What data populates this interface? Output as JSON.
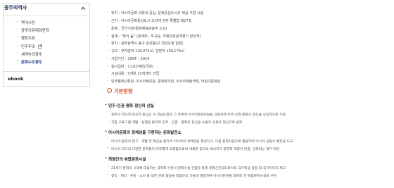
{
  "sidebar": {
    "header": "광주의역사",
    "items": [
      {
        "label": "역대시장",
        "active": false
      },
      {
        "label": "광주의유래와연혁",
        "active": false
      },
      {
        "label": "행정지표",
        "active": false
      },
      {
        "label": "민주주의",
        "active": false,
        "external": true
      },
      {
        "label": "세계속의광주",
        "active": false
      },
      {
        "label": "문화수도광주",
        "active": true
      }
    ],
    "ebook": "ebook"
  },
  "main": {
    "overview": [
      "위치 : 아시아문화 교류의 중심, 문화중심도시의 핵심 거점 시설",
      "근거 : 아시아문화중심도시 조성에 관한 특별법 제27조",
      "운영 : 국가기관(문화체육관광부 소속)",
      "설계 : \"빛의 숲\" (설계자 : 우규승, 국제건축설계경기 당선작)",
      "위치 : 광주광역시 동구 광산동(구 전남도청 일원)",
      "규모 : 부지면적 120,075㎡, 연면적 139,179㎡",
      "사업기간 : 2004 – 2014",
      "총사업비 : 7,162억원(국비)",
      "시설내용 : 5개원 13개센터 건립",
      "민주평화교류원, 아시아정보원, 문화창조원, 아시아예술극장, 어린이문화원"
    ],
    "section_title": "기본방향",
    "groups": [
      {
        "title": "민주·인권·평화 정신의 산실",
        "lines": [
          "광주의 역사적 정신적 중심인 구 전남도청과 그 주변에 아시아문화전당을 건립하여 민주·인권·평화의 정신을 상징적으로 구현",
          "각종 교류그램 개발 · 실행을 통하여 민주 · 인권 · 평화의 정신을 소통과 상생의 정신으로 승화"
        ]
      },
      {
        "title": "아시아문화의 정체성을 구현하는 문화발전소",
        "lines": [
          "아시아 문화의 연구 · 개발 및 확산을 통하여 아시아의 정체성을 형성하고, 이를 문화자원으로 활용하여 아시아 공동의 발전을 도모",
          "아시아 국가의 다양한 문화들이 자유롭게 교류함으로써 새로운 창작의 에너지가 문화적 역량이 분출, 강화되는 계기 마련"
        ]
      },
      {
        "title": "최첨단의 복합문화시설",
        "lines": [
          "21세기 문화의 시대에 대응하는 국제적 수준의 문화시설 건립을 통해 문화선진국으로서의 국가위상 정립 및 국가이미지 제고",
          "창작 · 제작 · 유통 · 소비 등 모든 문화 활동을 최첨단의 기술과 결합하여 아시아문화를 테마로 한 복합문화시설로 구현"
        ]
      }
    ]
  },
  "colors": {
    "accent": "#d1552e",
    "nav_active": "#1f3c8f",
    "border": "#dcdcdc"
  }
}
